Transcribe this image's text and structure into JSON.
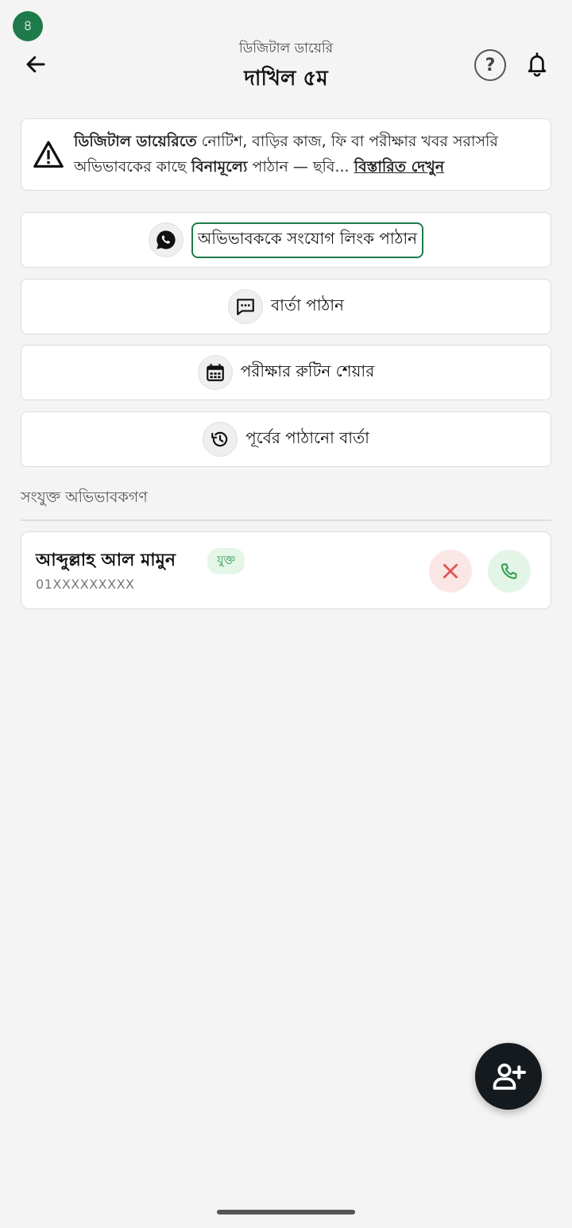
{
  "status": {
    "badge": "৪"
  },
  "header": {
    "subtitle": "ডিজিটাল ডায়েরি",
    "title": "দাখিল ৫ম",
    "help_label": "?"
  },
  "notice": {
    "bold_lead": "ডিজিটাল ডায়েরিতে",
    "text_1": " নোটিশ, বাড়ির কাজ, ফি বা পরীক্ষার খবর সরাসরি অভিভাবকের কাছে ",
    "bold_mid": "বিনামূল্যে",
    "text_2": " পাঠান — ছবি... ",
    "more_link": "বিস্তারিত দেখুন"
  },
  "actions": [
    {
      "label": "অভিভাবককে সংযোগ লিংক পাঠান",
      "icon": "whatsapp-icon"
    },
    {
      "label": "বার্তা পাঠান",
      "icon": "message-icon"
    },
    {
      "label": "পরীক্ষার রুটিন শেয়ার",
      "icon": "calendar-icon"
    },
    {
      "label": "পূর্বের পাঠানো বার্তা",
      "icon": "history-icon"
    }
  ],
  "guardians_section": {
    "title": "সংযুক্ত অভিভাবকগণ",
    "items": [
      {
        "name": "আব্দুল্লাহ আল মামুন",
        "status": "যুক্ত",
        "phone": "01XXXXXXXXX"
      }
    ]
  },
  "colors": {
    "accent": "#1e7a4a",
    "remove": "#e05555",
    "call": "#2e9c4c",
    "fab": "#151a1f"
  }
}
